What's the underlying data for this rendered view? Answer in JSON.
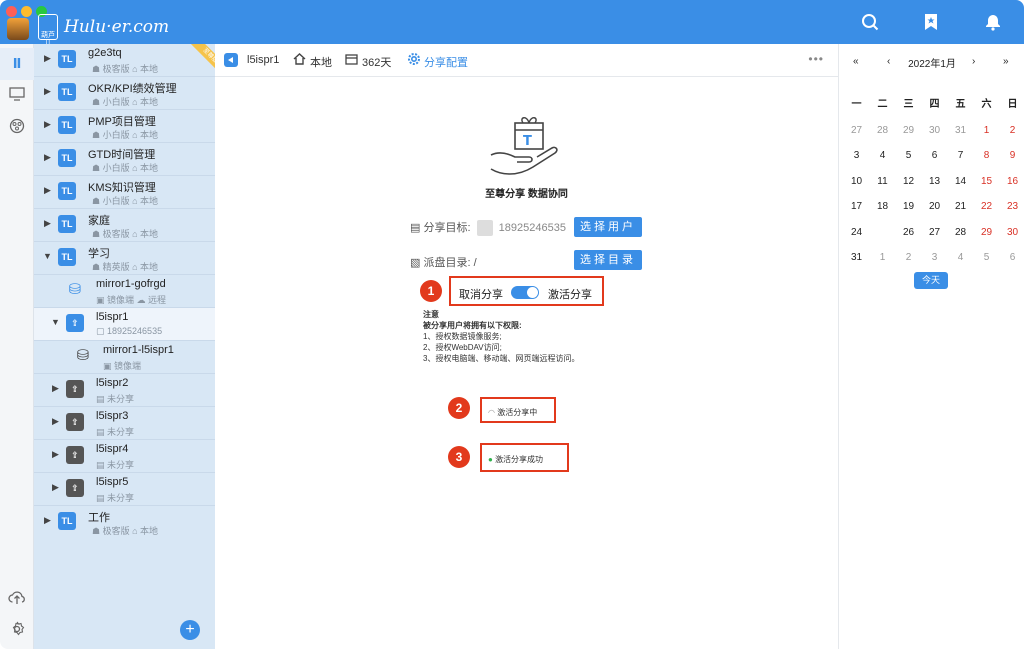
{
  "brand": {
    "badge_text": "葫芦儿",
    "name": "Hulu·er.com"
  },
  "tree": {
    "ribbon": "至尊版",
    "nodes": [
      {
        "title": "g2e3tq",
        "sub1": "极客版",
        "sub2": "本地"
      },
      {
        "title": "OKR/KPI绩效管理",
        "sub1": "小白版",
        "sub2": "本地"
      },
      {
        "title": "PMP项目管理",
        "sub1": "小白版",
        "sub2": "本地"
      },
      {
        "title": "GTD时间管理",
        "sub1": "小白版",
        "sub2": "本地"
      },
      {
        "title": "KMS知识管理",
        "sub1": "小白版",
        "sub2": "本地"
      },
      {
        "title": "家庭",
        "sub1": "极客版",
        "sub2": "本地"
      },
      {
        "title": "学习",
        "sub1": "精英版",
        "sub2": "本地"
      },
      {
        "title": "mirror1-gofrgd",
        "sub1": "镜像端",
        "sub2": "远程"
      },
      {
        "title": "l5ispr1",
        "sub1": "18925246535",
        "sub2": ""
      },
      {
        "title": "mirror1-l5ispr1",
        "sub1": "镜像端",
        "sub2": ""
      },
      {
        "title": "l5ispr2",
        "sub1": "未分享",
        "sub2": ""
      },
      {
        "title": "l5ispr3",
        "sub1": "未分享",
        "sub2": ""
      },
      {
        "title": "l5ispr4",
        "sub1": "未分享",
        "sub2": ""
      },
      {
        "title": "l5ispr5",
        "sub1": "未分享",
        "sub2": ""
      },
      {
        "title": "工作",
        "sub1": "极客版",
        "sub2": "本地"
      }
    ]
  },
  "toolbar": {
    "name": "l5ispr1",
    "location": "本地",
    "days": "362天",
    "config": "分享配置",
    "more": "•••"
  },
  "content": {
    "slogan": "至尊分享 数据协同",
    "share_target_label": "分享目标:",
    "share_target_phone": "18925246535",
    "select_user_btn": "选择用户",
    "dir_label": "派盘目录: /",
    "select_dir_btn": "选择目录",
    "cancel_share": "取消分享",
    "activate_share": "激活分享",
    "notice_title": "注意",
    "notice_head": "被分享用户将拥有以下权限:",
    "notice_1": "1、授权数据镜像服务;",
    "notice_2": "2、授权WebDAV访问;",
    "notice_3": "3、授权电脑端、移动端、网页端远程访问。",
    "status_activating": "激活分享中",
    "status_success": "激活分享成功",
    "callouts": [
      "1",
      "2",
      "3"
    ]
  },
  "calendar": {
    "nav_prev_year": "«",
    "nav_prev_month": "‹",
    "title": "2022年1月",
    "nav_next_month": "›",
    "nav_next_year": "»",
    "weekdays": [
      "一",
      "二",
      "三",
      "四",
      "五",
      "六",
      "日"
    ],
    "days": [
      [
        "27",
        "28",
        "29",
        "30",
        "31",
        "1",
        "2"
      ],
      [
        "3",
        "4",
        "5",
        "6",
        "7",
        "8",
        "9"
      ],
      [
        "10",
        "11",
        "12",
        "13",
        "14",
        "15",
        "16"
      ],
      [
        "17",
        "18",
        "19",
        "20",
        "21",
        "22",
        "23"
      ],
      [
        "24",
        "25",
        "26",
        "27",
        "28",
        "29",
        "30"
      ],
      [
        "31",
        "1",
        "2",
        "3",
        "4",
        "5",
        "6"
      ]
    ],
    "today_btn": "今天"
  },
  "colors": {
    "accent": "#3a8ee6",
    "callout_red": "#e2391c",
    "weekend_red": "#d93025"
  }
}
